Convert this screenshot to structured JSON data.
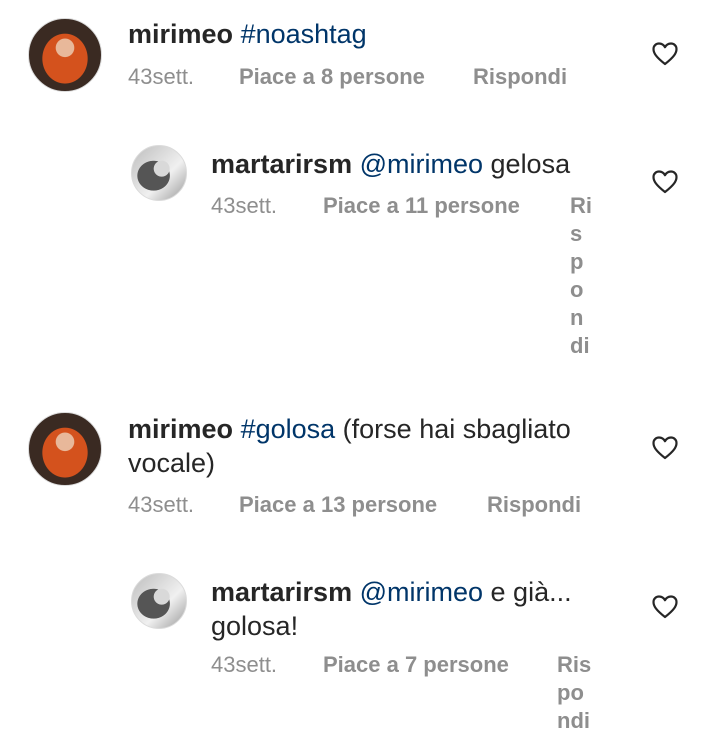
{
  "comments": [
    {
      "username": "mirimeo",
      "mention": "",
      "hashtag": "#noashtag",
      "text": "",
      "age": "43sett.",
      "likes": "Piace a 8 persone",
      "reply": "Rispondi"
    },
    {
      "username": "martarirsm",
      "mention": "@mirimeo",
      "hashtag": "",
      "text": "gelosa",
      "age": "43sett.",
      "likes": "Piace a 11 persone",
      "reply": "Rispondi"
    },
    {
      "username": "mirimeo",
      "mention": "",
      "hashtag": "#golosa",
      "text": "(forse hai sbagliato vocale)",
      "age": "43sett.",
      "likes": "Piace a 13 persone",
      "reply": "Rispondi"
    },
    {
      "username": "martarirsm",
      "mention": "@mirimeo",
      "hashtag": "",
      "text": "e già... golosa!",
      "age": "43sett.",
      "likes": "Piace a 7 persone",
      "reply": "Rispondi"
    }
  ],
  "icons": {
    "like": "heart-outline-icon",
    "avatar_1": "profile-photo-redhead",
    "avatar_2": "profile-photo-bw"
  },
  "colors": {
    "text": "#262626",
    "link": "#003569",
    "meta": "#8e8e8e"
  }
}
